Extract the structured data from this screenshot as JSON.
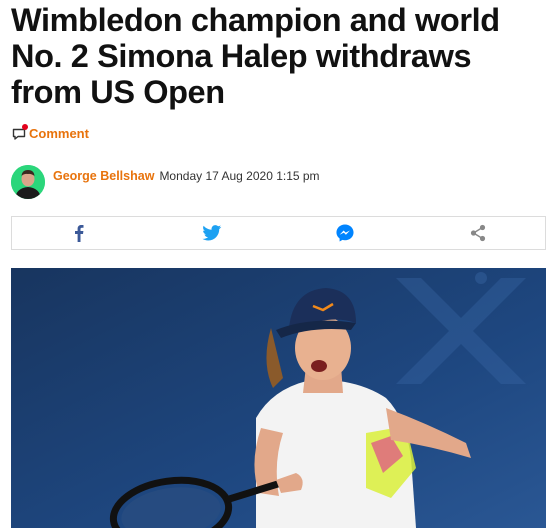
{
  "article": {
    "headline": "Wimbledon champion and world No. 2 Simona Halep withdraws from US Open"
  },
  "comment": {
    "label": "Comment",
    "icon": "comment-icon"
  },
  "byline": {
    "author": "George Bellshaw",
    "date": "Monday 17 Aug 2020 1:15 pm"
  },
  "share": {
    "buttons": [
      {
        "icon": "facebook-icon"
      },
      {
        "icon": "twitter-icon"
      },
      {
        "icon": "messenger-icon"
      },
      {
        "icon": "share-icon"
      }
    ]
  },
  "colors": {
    "accent": "#e8730c",
    "facebook": "#3b5998",
    "twitter": "#1da1f2",
    "messenger": "#0084ff",
    "share": "#888888",
    "avatar_bg": "#2bd67b"
  }
}
